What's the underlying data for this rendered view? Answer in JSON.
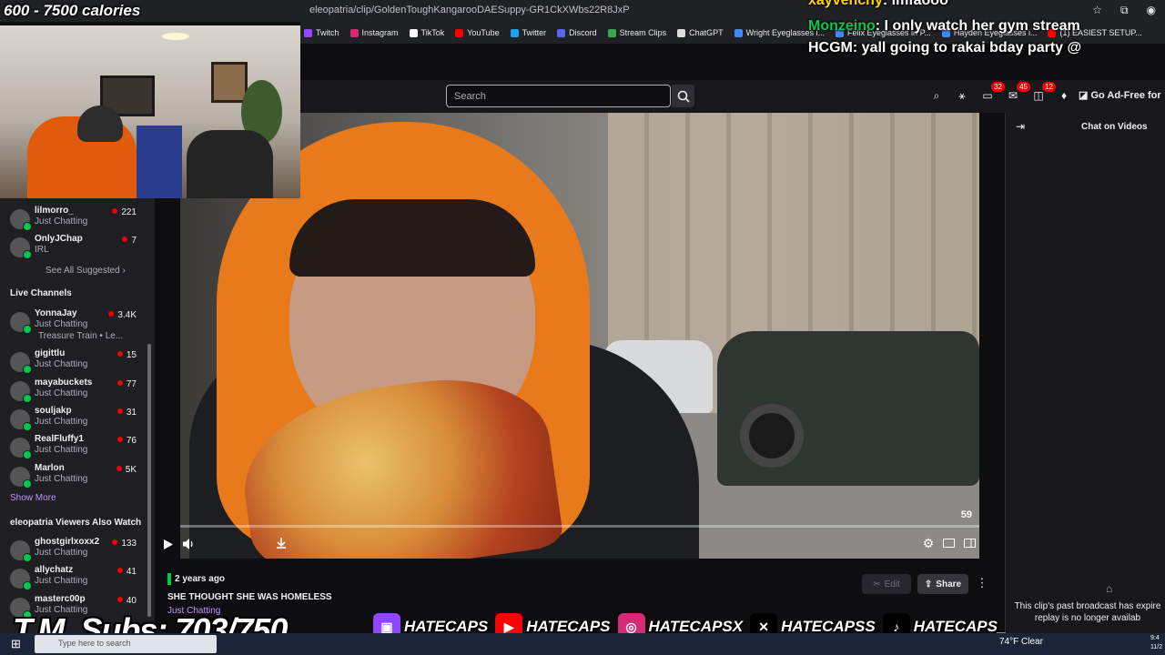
{
  "overlay": {
    "calories": "600 - 7500 calories",
    "subs": "T.M. Subs: 703/750",
    "chat": [
      {
        "user": "xayvenchy",
        "message": "lmfaooo",
        "color": "#ffd400"
      },
      {
        "user": "Monzeino",
        "message": "I only watch her gym stream",
        "color": "#00c853"
      },
      {
        "user": "HCGM",
        "message": "yall going to rakai bday party @",
        "color": "#ffffff"
      }
    ],
    "socials": [
      {
        "platform": "twitch-icon",
        "handle": "HATECAPS",
        "color": "#9146ff"
      },
      {
        "platform": "youtube-icon",
        "handle": "HATECAPS",
        "color": "#ff0000"
      },
      {
        "platform": "instagram-icon",
        "handle": "HATECAPSX",
        "color": "#d62976"
      },
      {
        "platform": "x-icon",
        "handle": "HATECAPSS",
        "color": "#000000"
      },
      {
        "platform": "tiktok-icon",
        "handle": "HATECAPS_",
        "color": "#000000"
      }
    ]
  },
  "browser": {
    "url": "eleopatria/clip/GoldenToughKangarooDAESuppy-GR1CkXWbs22R8JxP",
    "bookmarks": [
      {
        "label": "Twitch",
        "color": "#9146ff"
      },
      {
        "label": "Instagram",
        "color": "#d62976"
      },
      {
        "label": "TikTok",
        "color": "#ffffff"
      },
      {
        "label": "YouTube",
        "color": "#ff0000"
      },
      {
        "label": "Twitter",
        "color": "#1da1f2"
      },
      {
        "label": "Discord",
        "color": "#5865f2"
      },
      {
        "label": "Stream Clips",
        "color": "#34a853"
      },
      {
        "label": "ChatGPT",
        "color": "#dddddd"
      },
      {
        "label": "Wright Eyeglasses i...",
        "color": "#4285f4"
      },
      {
        "label": "Felix Eyeglasses in P...",
        "color": "#4285f4"
      },
      {
        "label": "Hayden Eyeglasses i...",
        "color": "#4285f4"
      },
      {
        "label": "(1) EASIEST SETUP...",
        "color": "#ff0000"
      }
    ]
  },
  "twitch": {
    "search_placeholder": "Search",
    "nav_badges": [
      "32",
      "45",
      "12"
    ],
    "ad_free": "Go Ad-Free for",
    "sidebar": {
      "suggested": [
        {
          "name": "lilmorro_",
          "category": "Just Chatting",
          "viewers": "221"
        },
        {
          "name": "OnlyJChap",
          "category": "IRL",
          "viewers": "7"
        }
      ],
      "see_all": "See All Suggested",
      "live_title": "Live Channels",
      "live": [
        {
          "name": "YonnaJay",
          "category": "Just Chatting",
          "viewers": "3.4K",
          "extra": "Treasure Train • Le..."
        },
        {
          "name": "gigittlu",
          "category": "Just Chatting",
          "viewers": "15"
        },
        {
          "name": "mayabuckets",
          "category": "Just Chatting",
          "viewers": "77"
        },
        {
          "name": "souljakp",
          "category": "Just Chatting",
          "viewers": "31"
        },
        {
          "name": "RealFluffy1",
          "category": "Just Chatting",
          "viewers": "76"
        },
        {
          "name": "Marlon",
          "category": "Just Chatting",
          "viewers": "5K"
        }
      ],
      "show_more": "Show More",
      "also_watch_title": "eleopatria Viewers Also Watch",
      "also_watch": [
        {
          "name": "ghostgirlxoxx2",
          "category": "Just Chatting",
          "viewers": "133"
        },
        {
          "name": "allychatz",
          "category": "Just Chatting",
          "viewers": "41"
        },
        {
          "name": "masterc00p",
          "category": "Just Chatting",
          "viewers": "40"
        }
      ]
    },
    "video": {
      "counter": "59",
      "progress": 0.0
    },
    "clip": {
      "age": "2 years ago",
      "title": "SHE THOUGHT SHE WAS HOMELESS",
      "category": "Just Chatting",
      "edit_label": "Edit",
      "share_label": "Share"
    },
    "right_panel": {
      "title": "Chat on Videos",
      "message_line1": "This clip's past broadcast has expire",
      "message_line2": "replay is no longer availab"
    }
  },
  "taskbar": {
    "search_placeholder": "Type here to search",
    "weather": "74°F  Clear",
    "clock_time": "9:4",
    "clock_date": "11/2"
  }
}
